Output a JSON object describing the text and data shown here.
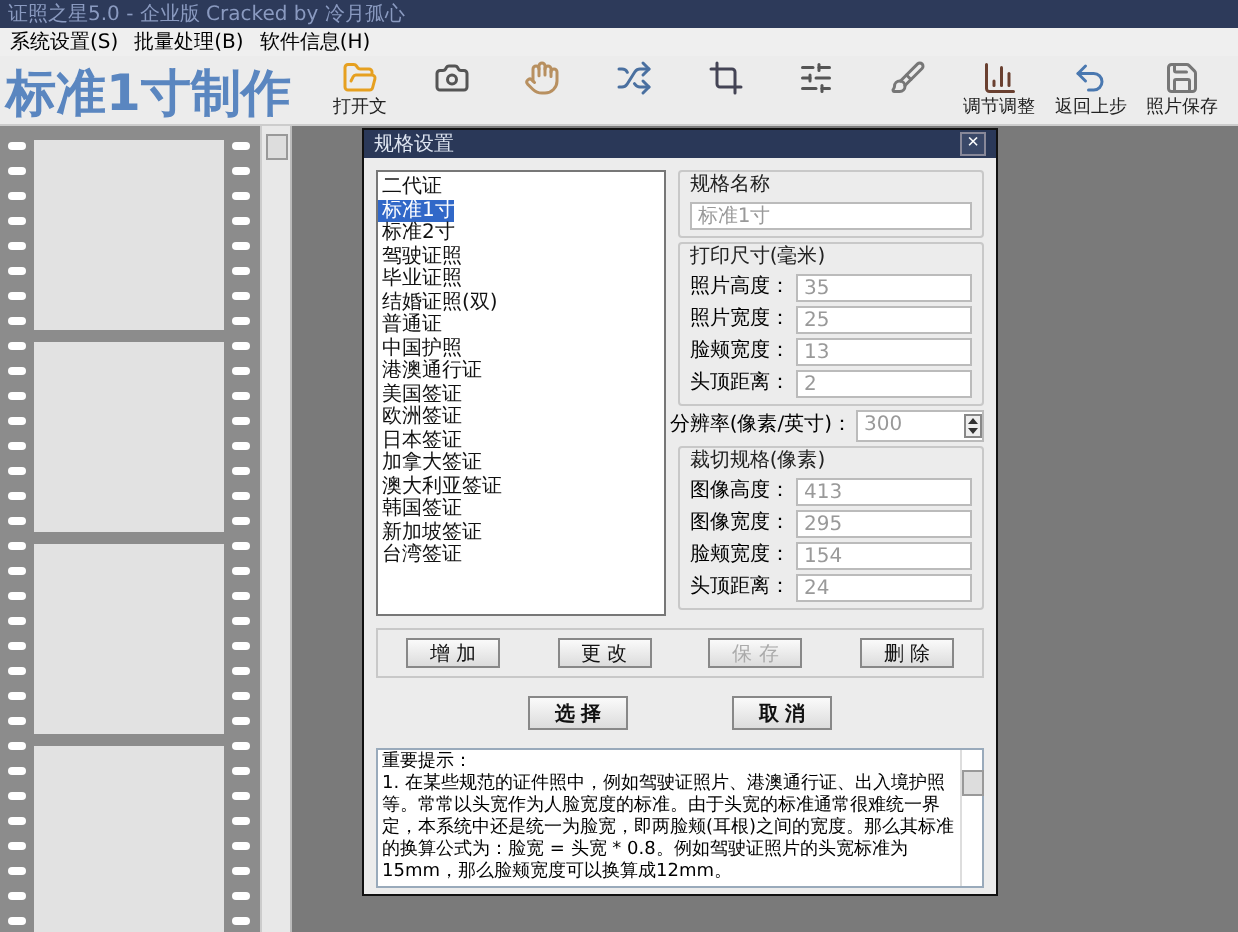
{
  "window": {
    "title": "证照之星5.0 - 企业版 Cracked by 冷月孤心"
  },
  "menu": [
    "系统设置(S)",
    "批量处理(B)",
    "软件信息(H)"
  ],
  "heading": "标准1寸制作",
  "toolbar": [
    {
      "kind": "folder",
      "label": "打开文"
    },
    {
      "kind": "camera"
    },
    {
      "kind": "hand"
    },
    {
      "kind": "shuffle"
    },
    {
      "kind": "crop"
    },
    {
      "kind": "sliders"
    },
    {
      "kind": "brush"
    },
    {
      "kind": "chart",
      "label": "调节调整"
    },
    {
      "kind": "undo",
      "label": "返回上步"
    },
    {
      "kind": "save",
      "label": "照片保存"
    }
  ],
  "dialog": {
    "title": "规格设置",
    "close": "×",
    "specs": [
      {
        "label": "二代证",
        "selected": false
      },
      {
        "label": "标准1寸",
        "selected": true
      },
      {
        "label": "标准2寸",
        "selected": false
      },
      {
        "label": "驾驶证照",
        "selected": false
      },
      {
        "label": "毕业证照",
        "selected": false
      },
      {
        "label": "结婚证照(双)",
        "selected": false
      },
      {
        "label": "普通证",
        "selected": false
      },
      {
        "label": "中国护照",
        "selected": false
      },
      {
        "label": "港澳通行证",
        "selected": false
      },
      {
        "label": "美国签证",
        "selected": false
      },
      {
        "label": "欧洲签证",
        "selected": false
      },
      {
        "label": "日本签证",
        "selected": false
      },
      {
        "label": "加拿大签证",
        "selected": false
      },
      {
        "label": "澳大利亚签证",
        "selected": false
      },
      {
        "label": "韩国签证",
        "selected": false
      },
      {
        "label": "新加坡签证",
        "selected": false
      },
      {
        "label": "台湾签证",
        "selected": false
      }
    ],
    "name_group": {
      "title": "规格名称",
      "value": "标准1寸"
    },
    "print_group": {
      "title": "打印尺寸(毫米)",
      "fields": [
        {
          "label": "照片高度：",
          "value": "35"
        },
        {
          "label": "照片宽度：",
          "value": "25"
        },
        {
          "label": "脸颊宽度：",
          "value": "13"
        },
        {
          "label": "头顶距离：",
          "value": "2"
        }
      ]
    },
    "resolution": {
      "label": "分辨率(像素/英寸)：",
      "value": "300"
    },
    "crop_group": {
      "title": "裁切规格(像素)",
      "fields": [
        {
          "label": "图像高度：",
          "value": "413"
        },
        {
          "label": "图像宽度：",
          "value": "295"
        },
        {
          "label": "脸颊宽度：",
          "value": "154"
        },
        {
          "label": "头顶距离：",
          "value": "24"
        }
      ]
    },
    "edit_buttons": [
      {
        "label": "增 加",
        "disabled": false
      },
      {
        "label": "更 改",
        "disabled": false
      },
      {
        "label": "保 存",
        "disabled": true
      },
      {
        "label": "删 除",
        "disabled": false
      }
    ],
    "main_buttons": [
      {
        "label": "选 择"
      },
      {
        "label": "取 消"
      }
    ],
    "notes": {
      "heading": "重要提示：",
      "text": "1. 在某些规范的证件照中，例如驾驶证照片、港澳通行证、出入境护照等。常常以头宽作为人脸宽度的标准。由于头宽的标准通常很难统一界定，本系统中还是统一为脸宽，即两脸颊(耳根)之间的宽度。那么其标准的换算公式为：脸宽 = 头宽 * 0.8。例如驾驶证照片的头宽标准为15mm，那么脸颊宽度可以换算成12mm。"
    }
  }
}
